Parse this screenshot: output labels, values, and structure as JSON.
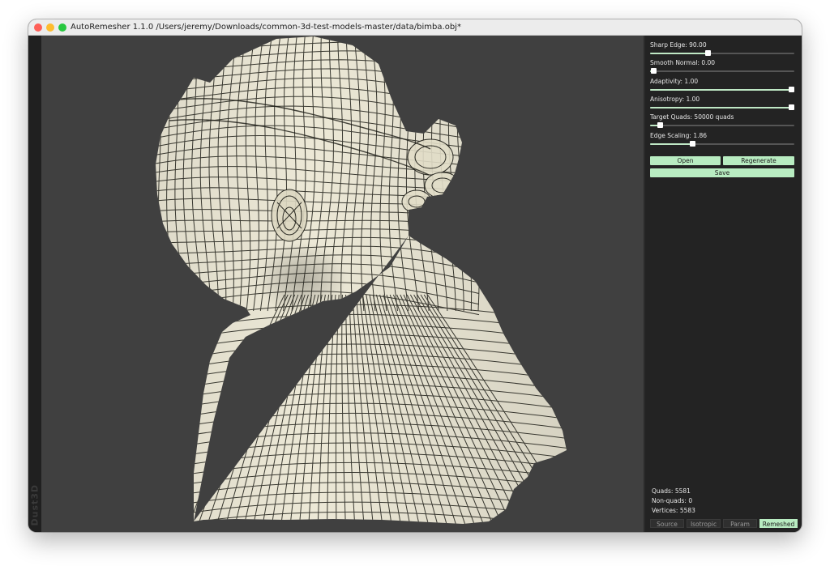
{
  "window": {
    "title": "AutoRemesher 1.1.0 /Users/jeremy/Downloads/common-3d-test-models-master/data/bimba.obj*"
  },
  "logo": {
    "text": "Dust3D"
  },
  "controls": {
    "sharp_edge": {
      "label": "Sharp Edge: 90.00",
      "fraction": 0.4
    },
    "smooth_normal": {
      "label": "Smooth Normal: 0.00",
      "fraction": 0.02
    },
    "adaptivity": {
      "label": "Adaptivity: 1.00",
      "fraction": 0.98
    },
    "anisotropy": {
      "label": "Anisotropy: 1.00",
      "fraction": 0.98
    },
    "target_quads": {
      "label": "Target Quads: 50000 quads",
      "fraction": 0.07
    },
    "edge_scaling": {
      "label": "Edge Scaling: 1.86",
      "fraction": 0.29
    }
  },
  "buttons": {
    "open": "Open",
    "regenerate": "Regenerate",
    "save": "Save"
  },
  "stats": {
    "quads": "Quads: 5581",
    "non_quads": "Non-quads: 0",
    "vertices": "Vertices: 5583"
  },
  "tabs": [
    {
      "label": "Source",
      "active": false
    },
    {
      "label": "Isotropic",
      "active": false
    },
    {
      "label": "Param",
      "active": false
    },
    {
      "label": "Remeshed",
      "active": true
    }
  ],
  "colors": {
    "accent": "#b8ecc1",
    "mesh_fill": "#ece8d6",
    "mesh_lines": "#1a1a14",
    "viewport_bg": "#404040",
    "panel_bg": "#232323"
  }
}
